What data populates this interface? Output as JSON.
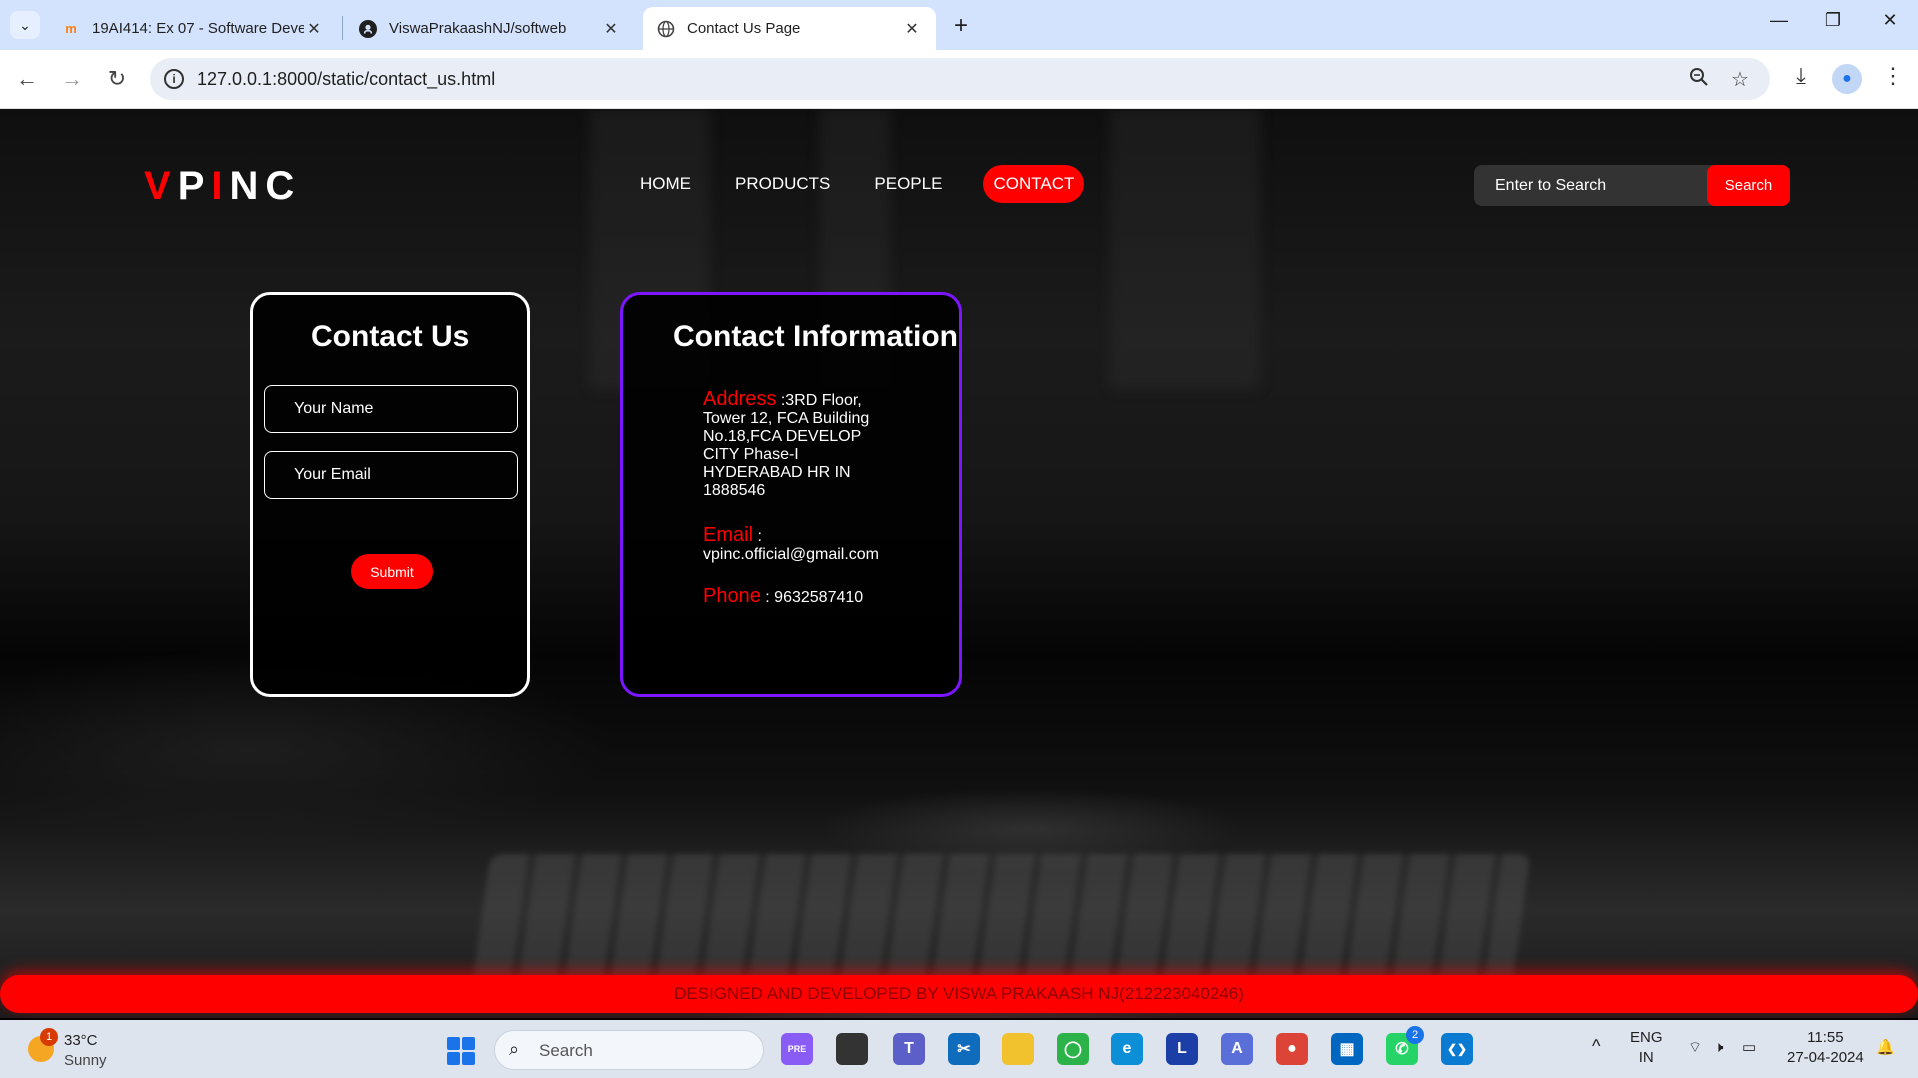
{
  "browser": {
    "tabs": [
      {
        "title": "19AI414: Ex 07 - Software Deve",
        "favicon": "moodle-icon",
        "active": false
      },
      {
        "title": "ViswaPrakaashNJ/softweb",
        "favicon": "github-icon",
        "active": false
      },
      {
        "title": "Contact Us Page",
        "favicon": "globe-icon",
        "active": true
      }
    ],
    "url": "127.0.0.1:8000/static/contact_us.html"
  },
  "site": {
    "logo": {
      "v": "V",
      "p": "P",
      "i": "I",
      "nc": "NC"
    },
    "nav": [
      "HOME",
      "PRODUCTS",
      "PEOPLE",
      "CONTACT"
    ],
    "active_nav": "CONTACT",
    "search": {
      "placeholder": "Enter to Search",
      "button": "Search"
    }
  },
  "contact_form": {
    "title": "Contact Us",
    "name_placeholder": "Your Name",
    "email_placeholder": "Your Email",
    "submit": "Submit"
  },
  "contact_info": {
    "title": "Contact Information",
    "address_label": "Address",
    "address_value": " :3RD Floor, Tower 12, FCA Building No.18,FCA DEVELOP CITY Phase-I HYDERABAD HR IN 1888546",
    "email_label": "Email",
    "email_sep": " :",
    "email_value": "vpinc.official@gmail.com",
    "phone_label": "Phone",
    "phone_value": " : 9632587410"
  },
  "footer": "DESIGNED AND DEVELOPED BY VISWA PRAKAASH NJ(212223040246)",
  "taskbar": {
    "weather_badge": "1",
    "temperature": "33°C",
    "condition": "Sunny",
    "search": "Search",
    "apps": [
      {
        "name": "copilot",
        "label": "PRE",
        "color": "#8a5cf6"
      },
      {
        "name": "taskview",
        "label": "",
        "color": "#333333"
      },
      {
        "name": "teams",
        "label": "T",
        "color": "#5b5fc7"
      },
      {
        "name": "snipping",
        "label": "✂",
        "color": "#0f6cbd"
      },
      {
        "name": "explorer",
        "label": "",
        "color": "#f2c12e"
      },
      {
        "name": "refresh",
        "label": "◯",
        "color": "#2bb34a"
      },
      {
        "name": "edge",
        "label": "e",
        "color": "#0c8fd6"
      },
      {
        "name": "l-app",
        "label": "L",
        "color": "#1b3fa6"
      },
      {
        "name": "arc",
        "label": "A",
        "color": "#5a6fd8"
      },
      {
        "name": "chrome",
        "label": "●",
        "color": "#db4437"
      },
      {
        "name": "store",
        "label": "▦",
        "color": "#0067c0"
      },
      {
        "name": "whatsapp",
        "label": "✆",
        "color": "#25d366"
      },
      {
        "name": "vscode",
        "label": "❮❯",
        "color": "#0a7bd1"
      }
    ],
    "whatsapp_badge": "2",
    "language": "ENG",
    "region": "IN",
    "time": "11:55",
    "date": "27-04-2024"
  }
}
